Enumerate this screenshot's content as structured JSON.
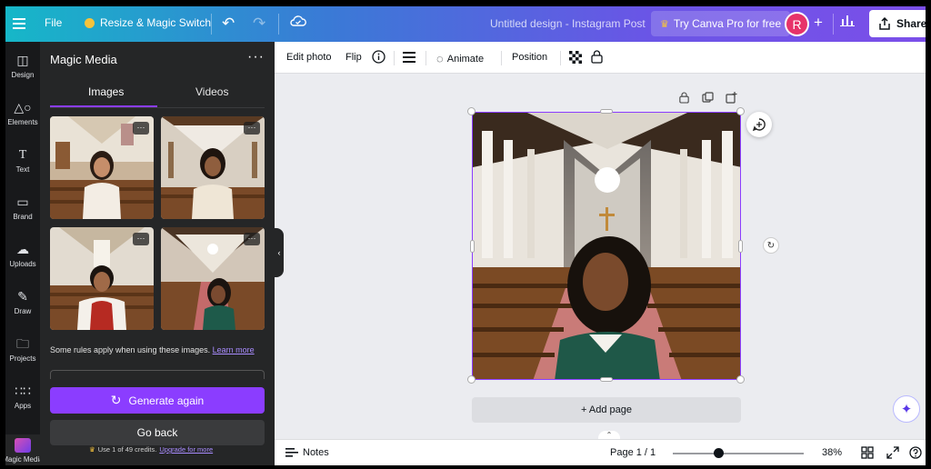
{
  "topbar": {
    "file_label": "File",
    "resize_label": "Resize & Magic Switch",
    "title": "Untitled design - Instagram Post",
    "try_pro_label": "Try Canva Pro for free",
    "avatar_initial": "R",
    "share_label": "Share"
  },
  "rail": {
    "items": [
      {
        "label": "Design",
        "icon": "design-icon"
      },
      {
        "label": "Elements",
        "icon": "elements-icon"
      },
      {
        "label": "Text",
        "icon": "text-icon"
      },
      {
        "label": "Brand",
        "icon": "brand-icon"
      },
      {
        "label": "Uploads",
        "icon": "uploads-icon"
      },
      {
        "label": "Draw",
        "icon": "draw-icon"
      },
      {
        "label": "Projects",
        "icon": "projects-icon"
      },
      {
        "label": "Apps",
        "icon": "apps-icon"
      },
      {
        "label": "Magic Media",
        "icon": "magic-media-icon"
      }
    ]
  },
  "panel": {
    "title": "Magic Media",
    "tabs": [
      "Images",
      "Videos"
    ],
    "rules_text": "Some rules apply when using these images.",
    "learn_more": "Learn more",
    "generate_label": "Generate again",
    "back_label": "Go back",
    "credits_text": "Use 1 of 49 credits.",
    "upgrade_label": "Upgrade for more"
  },
  "toolbar": {
    "edit_photo": "Edit photo",
    "flip": "Flip",
    "animate": "Animate",
    "position": "Position"
  },
  "canvas": {
    "add_page": "+ Add page"
  },
  "bottombar": {
    "notes": "Notes",
    "page": "Page 1 / 1",
    "zoom": "38%",
    "zoom_level": 0.38
  },
  "colors": {
    "accent": "#8b3dff",
    "panel_bg": "#252627",
    "rail_bg": "#18191b"
  }
}
